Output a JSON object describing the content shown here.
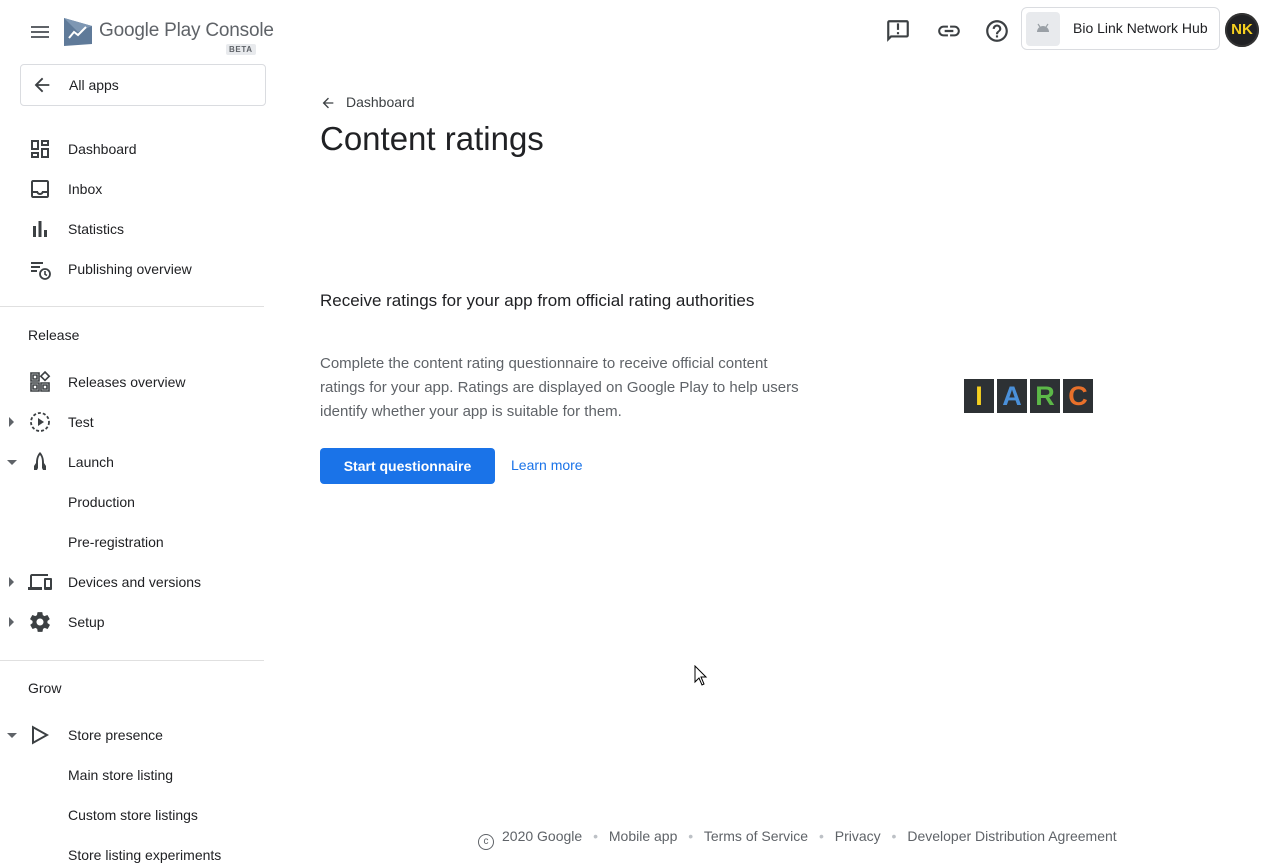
{
  "header": {
    "brand_google": "Google Play",
    "brand_console": "Console",
    "beta_badge": "BETA",
    "app_name": "Bio Link Network Hub",
    "avatar_initials": "NK",
    "icons": [
      "menu-icon",
      "feedback-icon",
      "link-icon",
      "help-icon",
      "android-icon"
    ]
  },
  "sidebar": {
    "all_apps": "All apps",
    "top_items": [
      {
        "label": "Dashboard",
        "icon": "dashboard-icon"
      },
      {
        "label": "Inbox",
        "icon": "inbox-icon"
      },
      {
        "label": "Statistics",
        "icon": "statistics-icon"
      },
      {
        "label": "Publishing overview",
        "icon": "publishing-overview-icon"
      }
    ],
    "release_title": "Release",
    "release_items": [
      {
        "label": "Releases overview",
        "icon": "releases-overview-icon"
      },
      {
        "label": "Test",
        "icon": "test-icon"
      },
      {
        "label": "Launch",
        "icon": "launch-icon"
      },
      {
        "label": "Production"
      },
      {
        "label": "Pre-registration"
      },
      {
        "label": "Devices and versions",
        "icon": "devices-icon"
      },
      {
        "label": "Setup",
        "icon": "settings-icon"
      }
    ],
    "grow_title": "Grow",
    "grow_items": [
      {
        "label": "Store presence",
        "icon": "store-presence-icon"
      },
      {
        "label": "Main store listing"
      },
      {
        "label": "Custom store listings"
      },
      {
        "label": "Store listing experiments"
      }
    ]
  },
  "main": {
    "breadcrumb": "Dashboard",
    "title": "Content ratings",
    "card_heading": "Receive ratings for your app from official rating authorities",
    "card_body": "Complete the content rating questionnaire to receive official content ratings for your app. Ratings are displayed on Google Play to help users identify whether your app is suitable for them.",
    "primary_button": "Start questionnaire",
    "learn_more": "Learn more",
    "iarc_letters": [
      "I",
      "A",
      "R",
      "C"
    ],
    "iarc_colors": [
      "#f5d020",
      "#4a90d9",
      "#5cb848",
      "#e8702a"
    ]
  },
  "footer": {
    "copyright": "2020 Google",
    "links": [
      "Mobile app",
      "Terms of Service",
      "Privacy",
      "Developer Distribution Agreement"
    ]
  },
  "colors": {
    "primary": "#1a73e8",
    "text": "#202124",
    "secondary_text": "#5f6368"
  }
}
